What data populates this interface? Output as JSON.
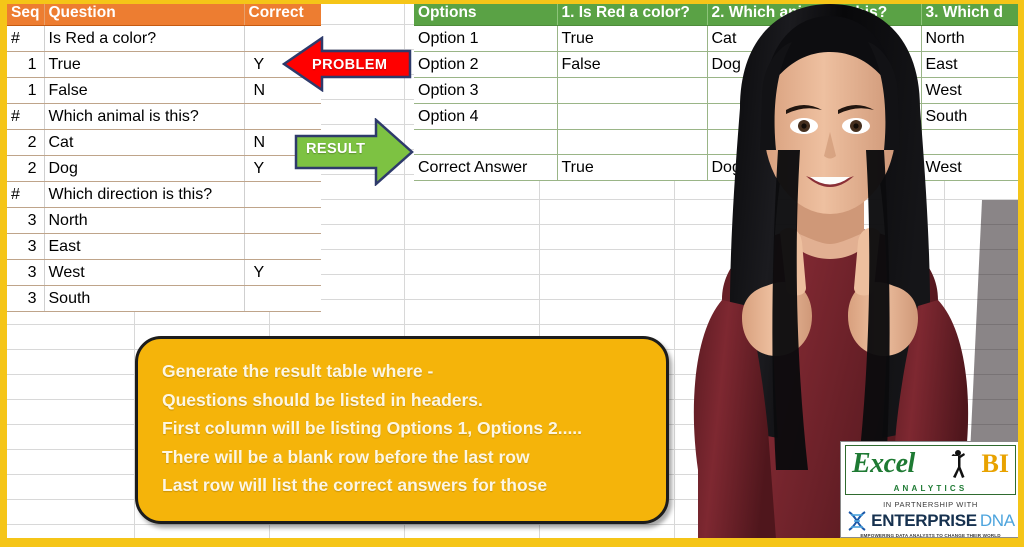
{
  "theme": {
    "problem_header_bg": "#ED7D31",
    "result_header_bg": "#5AA245",
    "callout_bg": "#F5B40A",
    "callout_text": "#FDF6E3",
    "frame_yellow": "#F5C518",
    "problem_arrow": "#FF0000",
    "result_arrow": "#7DC242",
    "grid_line": "#D8D8D8"
  },
  "problem_table": {
    "title": "problem-table",
    "columns": [
      "Seq",
      "Question",
      "Correct"
    ],
    "rows": [
      {
        "seq": "#",
        "question": "Is Red a color?",
        "correct": ""
      },
      {
        "seq": "1",
        "question": "True",
        "correct": "Y"
      },
      {
        "seq": "1",
        "question": "False",
        "correct": "N"
      },
      {
        "seq": "#",
        "question": "Which animal is this?",
        "correct": ""
      },
      {
        "seq": "2",
        "question": "Cat",
        "correct": "N"
      },
      {
        "seq": "2",
        "question": "Dog",
        "correct": "Y"
      },
      {
        "seq": "#",
        "question": "Which direction is this?",
        "correct": ""
      },
      {
        "seq": "3",
        "question": "North",
        "correct": ""
      },
      {
        "seq": "3",
        "question": "East",
        "correct": ""
      },
      {
        "seq": "3",
        "question": "West",
        "correct": "Y"
      },
      {
        "seq": "3",
        "question": "South",
        "correct": ""
      }
    ]
  },
  "result_table": {
    "title": "result-table",
    "columns": [
      "Options",
      "1. Is Red a color?",
      "2. Which animal is this?",
      "3. Which d"
    ],
    "rows": [
      {
        "label": "Option 1",
        "q1": "True",
        "q2": "Cat",
        "q3": "North"
      },
      {
        "label": "Option 2",
        "q1": "False",
        "q2": "Dog",
        "q3": "East"
      },
      {
        "label": "Option 3",
        "q1": "",
        "q2": "",
        "q3": "West"
      },
      {
        "label": "Option 4",
        "q1": "",
        "q2": "",
        "q3": "South"
      },
      {
        "label": "",
        "q1": "",
        "q2": "",
        "q3": ""
      },
      {
        "label": "Correct Answer",
        "q1": "True",
        "q2": "Dog",
        "q3": "West"
      }
    ]
  },
  "arrows": {
    "problem_label": "PROBLEM",
    "result_label": "RESULT"
  },
  "callout": {
    "lines": [
      "Generate the result table where -",
      "Questions should be listed in headers.",
      "First column will be listing Options 1, Options 2.....",
      "There will be a blank row before the last row",
      "Last row will list the correct answers for those"
    ]
  },
  "logo": {
    "excel": "Excel",
    "bi": "BI",
    "analytics": "ANALYTICS",
    "partnership": "IN PARTNERSHIP WITH",
    "enterprise": "ENTERPRISE",
    "dna": "DNA",
    "tagline": "EMPOWERING DATA ANALYSTS TO CHANGE THEIR WORLD"
  }
}
